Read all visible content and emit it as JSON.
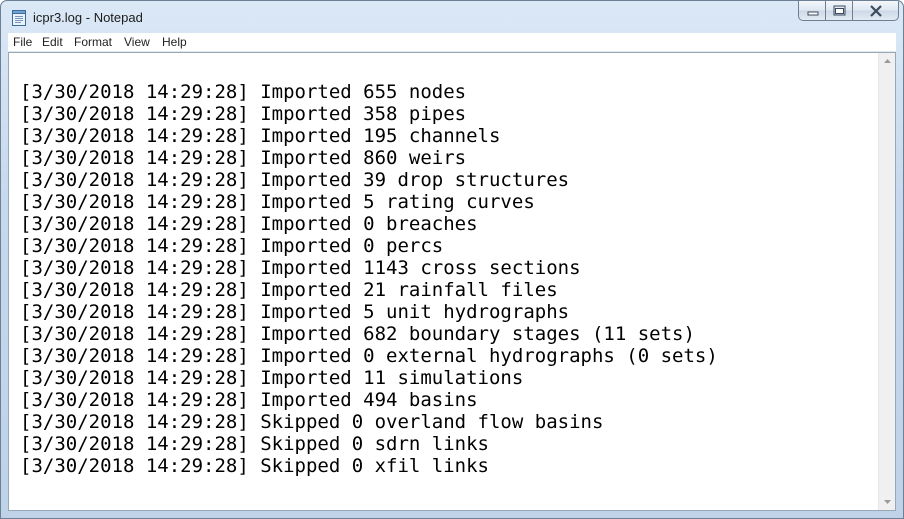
{
  "window": {
    "title": "icpr3.log - Notepad",
    "buttons": {
      "minimize_icon": "minimize-icon",
      "maximize_icon": "maximize-icon",
      "close_icon": "close-icon"
    }
  },
  "menu": [
    "File",
    "Edit",
    "Format",
    "View",
    "Help"
  ],
  "log_lines": [
    "[3/30/2018 14:29:28] Imported 655 nodes",
    "[3/30/2018 14:29:28] Imported 358 pipes",
    "[3/30/2018 14:29:28] Imported 195 channels",
    "[3/30/2018 14:29:28] Imported 860 weirs",
    "[3/30/2018 14:29:28] Imported 39 drop structures",
    "[3/30/2018 14:29:28] Imported 5 rating curves",
    "[3/30/2018 14:29:28] Imported 0 breaches",
    "[3/30/2018 14:29:28] Imported 0 percs",
    "[3/30/2018 14:29:28] Imported 1143 cross sections",
    "[3/30/2018 14:29:28] Imported 21 rainfall files",
    "[3/30/2018 14:29:28] Imported 5 unit hydrographs",
    "[3/30/2018 14:29:28] Imported 682 boundary stages (11 sets)",
    "[3/30/2018 14:29:28] Imported 0 external hydrographs (0 sets)",
    "[3/30/2018 14:29:28] Imported 11 simulations",
    "[3/30/2018 14:29:28] Imported 494 basins",
    "[3/30/2018 14:29:28] Skipped 0 overland flow basins",
    "[3/30/2018 14:29:28] Skipped 0 sdrn links",
    "[3/30/2018 14:29:28] Skipped 0 xfil links"
  ],
  "icons": {
    "app": "notepad-icon",
    "scroll_up": "scroll-up-arrow-icon",
    "scroll_down": "scroll-down-arrow-icon"
  },
  "colors": {
    "frame": "#bed2e8",
    "text": "#000000",
    "background": "#ffffff"
  }
}
